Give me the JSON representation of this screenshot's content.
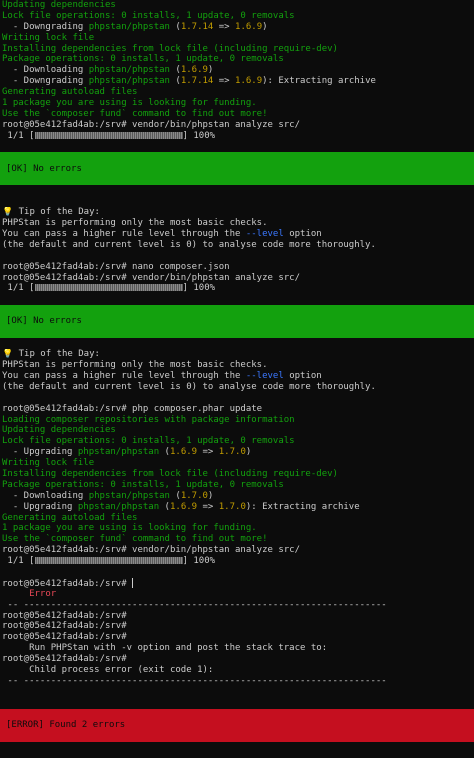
{
  "terminal": {
    "prompt": "root@05e412fad4ab:/srv#",
    "block1": {
      "updating_deps": "Updating dependencies",
      "lock_ops": "Lock file operations: 0 installs, 1 update, 0 removals",
      "downgrade1_prefix": "  - Downgrading ",
      "downgrade1_pkg": "phpstan/phpstan",
      "downgrade1_open": " (",
      "downgrade1_from": "1.7.14",
      "downgrade1_arrow": " => ",
      "downgrade1_to": "1.6.9",
      "downgrade1_close": ")",
      "writing_lock": "Writing lock file",
      "installing_deps": "Installing dependencies from lock file (including require-dev)",
      "pkg_ops": "Package operations: 0 installs, 1 update, 0 removals",
      "downloading_prefix": "  - Downloading ",
      "downloading_pkg": "phpstan/phpstan",
      "downloading_open": " (",
      "downloading_ver": "1.6.9",
      "downloading_close": ")",
      "downgrade2_prefix": "  - Downgrading ",
      "downgrade2_pkg": "phpstan/phpstan",
      "downgrade2_open": " (",
      "downgrade2_from": "1.7.14",
      "downgrade2_arrow": " => ",
      "downgrade2_to": "1.6.9",
      "downgrade2_close": "): Extracting archive",
      "gen_autoload": "Generating autoload files",
      "funding1": "1 package you are using is looking for funding.",
      "funding2": "Use the `composer fund` command to find out more!",
      "cmd_analyze": " vendor/bin/phpstan analyze src/",
      "progress_prefix": " 1/1 [",
      "progress_suffix": "] 100%"
    },
    "ok_message": "[OK] No errors",
    "tip": {
      "icon": "💡",
      "title": " Tip of the Day:",
      "line1": "PHPStan is performing only the most basic checks.",
      "line2_a": "You can pass a higher rule level through the ",
      "line2_opt": "--level",
      "line2_b": " option",
      "line3": "(the default and current level is 0) to analyse code more thoroughly."
    },
    "cmd_nano": " nano composer.json",
    "cmd_update": " php composer.phar update",
    "block2": {
      "loading_repos": "Loading composer repositories with package information",
      "updating_deps": "Updating dependencies",
      "lock_ops": "Lock file operations: 0 installs, 1 update, 0 removals",
      "upgrade1_prefix": "  - Upgrading ",
      "upgrade1_pkg": "phpstan/phpstan",
      "upgrade1_open": " (",
      "upgrade1_from": "1.6.9",
      "upgrade1_arrow": " => ",
      "upgrade1_to": "1.7.0",
      "upgrade1_close": ")",
      "writing_lock": "Writing lock file",
      "installing_deps": "Installing dependencies from lock file (including require-dev)",
      "pkg_ops": "Package operations: 0 installs, 1 update, 0 removals",
      "downloading_prefix": "  - Downloading ",
      "downloading_pkg": "phpstan/phpstan",
      "downloading_open": " (",
      "downloading_ver": "1.7.0",
      "downloading_close": ")",
      "upgrade2_prefix": "  - Upgrading ",
      "upgrade2_pkg": "phpstan/phpstan",
      "upgrade2_open": " (",
      "upgrade2_from": "1.6.9",
      "upgrade2_arrow": " => ",
      "upgrade2_to": "1.7.0",
      "upgrade2_close": "): Extracting archive",
      "gen_autoload": "Generating autoload files",
      "funding1": "1 package you are using is looking for funding.",
      "funding2": "Use the `composer fund` command to find out more!"
    },
    "error_table": {
      "header": "     Error",
      "rule": " -- -------------------------------------------------------------------",
      "msg": "     Run PHPStan with -v option and post the stack trace to:",
      "child_err": "     Child process error (exit code 1):"
    },
    "error_message": "[ERROR] Found 2 errors"
  }
}
